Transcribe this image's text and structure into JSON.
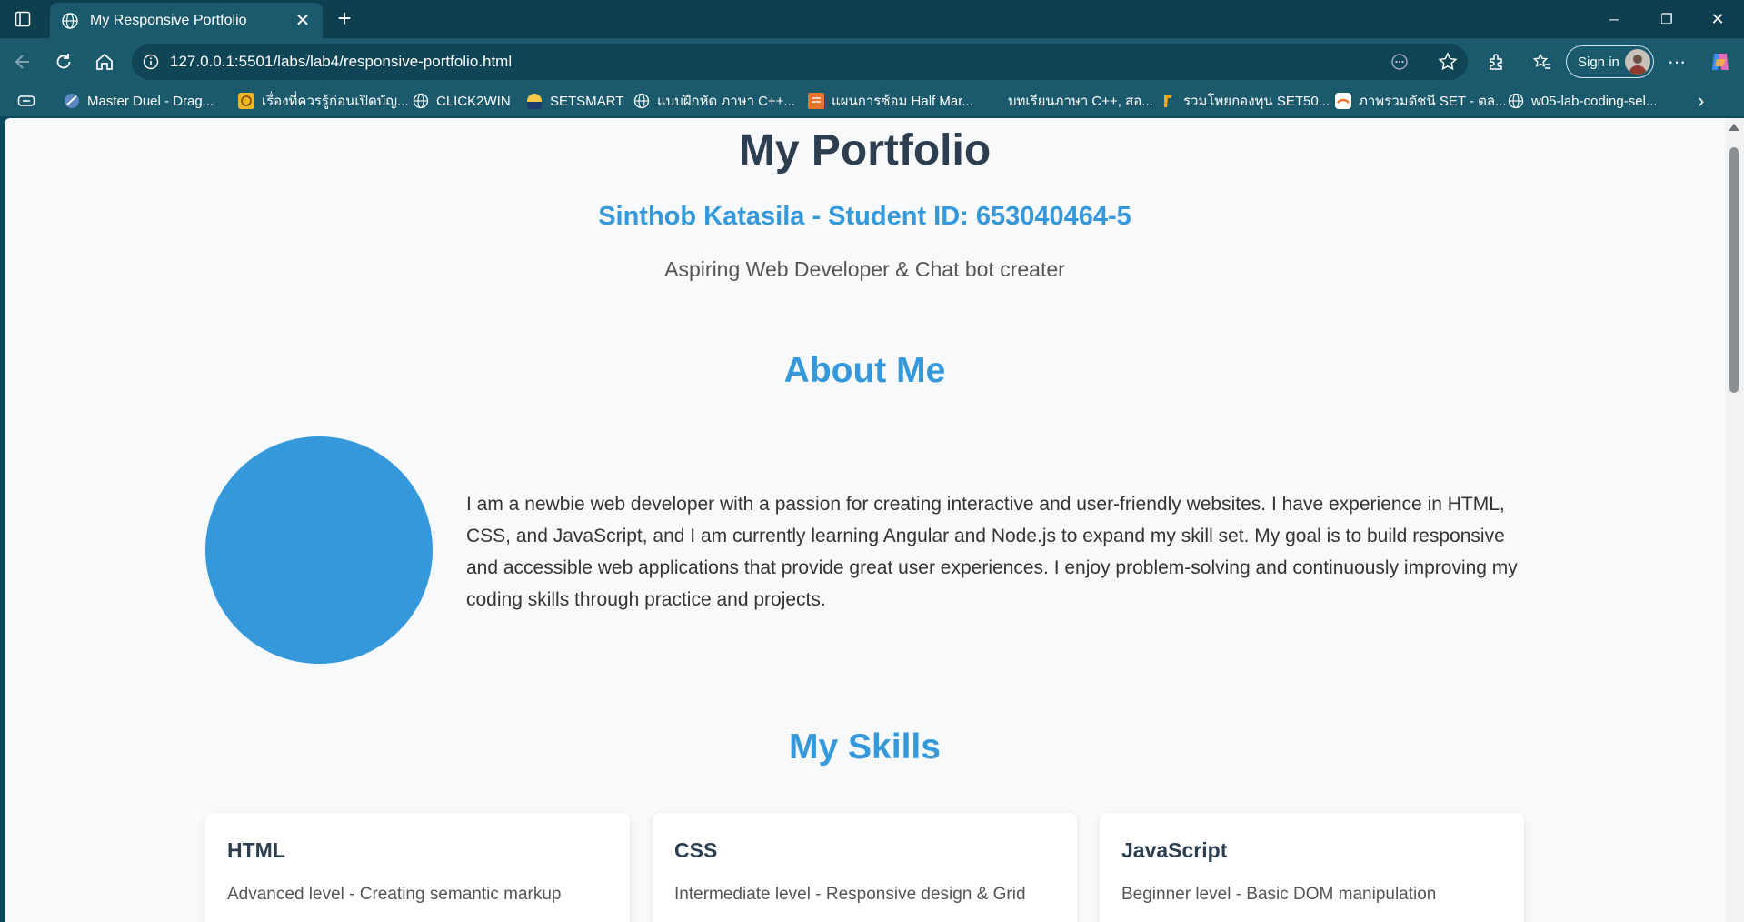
{
  "browser": {
    "tab_title": "My Responsive Portfolio",
    "tab_close": "✕",
    "new_tab": "+",
    "url": "127.0.0.1:5501/labs/lab4/responsive-portfolio.html",
    "signin_label": "Sign in",
    "window_controls": {
      "minimize": "─",
      "restore": "❐",
      "close": "✕"
    },
    "more_menu": "⋯",
    "bookmarks_more": "›",
    "bookmarks": [
      {
        "label": "Master Duel - Drag...",
        "icon": "game-icon"
      },
      {
        "label": "เรื่องที่ควรรู้ก่อนเปิดบัญ...",
        "icon": "bank-icon"
      },
      {
        "label": "CLICK2WIN",
        "icon": "globe-icon"
      },
      {
        "label": "SETSMART",
        "icon": "setsmart-icon"
      },
      {
        "label": "แบบฝึกหัด ภาษา C++...",
        "icon": "globe-icon"
      },
      {
        "label": "แผนการซ้อม Half Mar...",
        "icon": "plan-icon"
      },
      {
        "label": "บทเรียนภาษา C++, สอ...",
        "icon": "blank-icon"
      },
      {
        "label": "รวมโพยกองทุน SET50...",
        "icon": "fund-icon"
      },
      {
        "label": "ภาพรวมดัชนี SET - ตล...",
        "icon": "set-icon"
      },
      {
        "label": "w05-lab-coding-sel...",
        "icon": "globe-icon"
      }
    ]
  },
  "colors": {
    "accent": "#3498db",
    "heading": "#2c3e50",
    "page_bg": "#f7f9fa"
  },
  "page": {
    "title": "My Portfolio",
    "subtitle": "Sinthob Katasila - Student ID: 653040464-5",
    "tagline": "Aspiring Web Developer & Chat bot creater",
    "about": {
      "heading": "About Me",
      "text": "I am a newbie web developer with a passion for creating interactive and user-friendly websites. I have experience in HTML, CSS, and JavaScript, and I am currently learning Angular and Node.js to expand my skill set. My goal is to build responsive and accessible web applications that provide great user experiences. I enjoy problem-solving and continuously improving my coding skills through practice and projects."
    },
    "skills": {
      "heading": "My Skills",
      "items": [
        {
          "name": "HTML",
          "desc": "Advanced level - Creating semantic markup"
        },
        {
          "name": "CSS",
          "desc": "Intermediate level - Responsive design & Grid"
        },
        {
          "name": "JavaScript",
          "desc": "Beginner level - Basic DOM manipulation"
        }
      ]
    }
  }
}
